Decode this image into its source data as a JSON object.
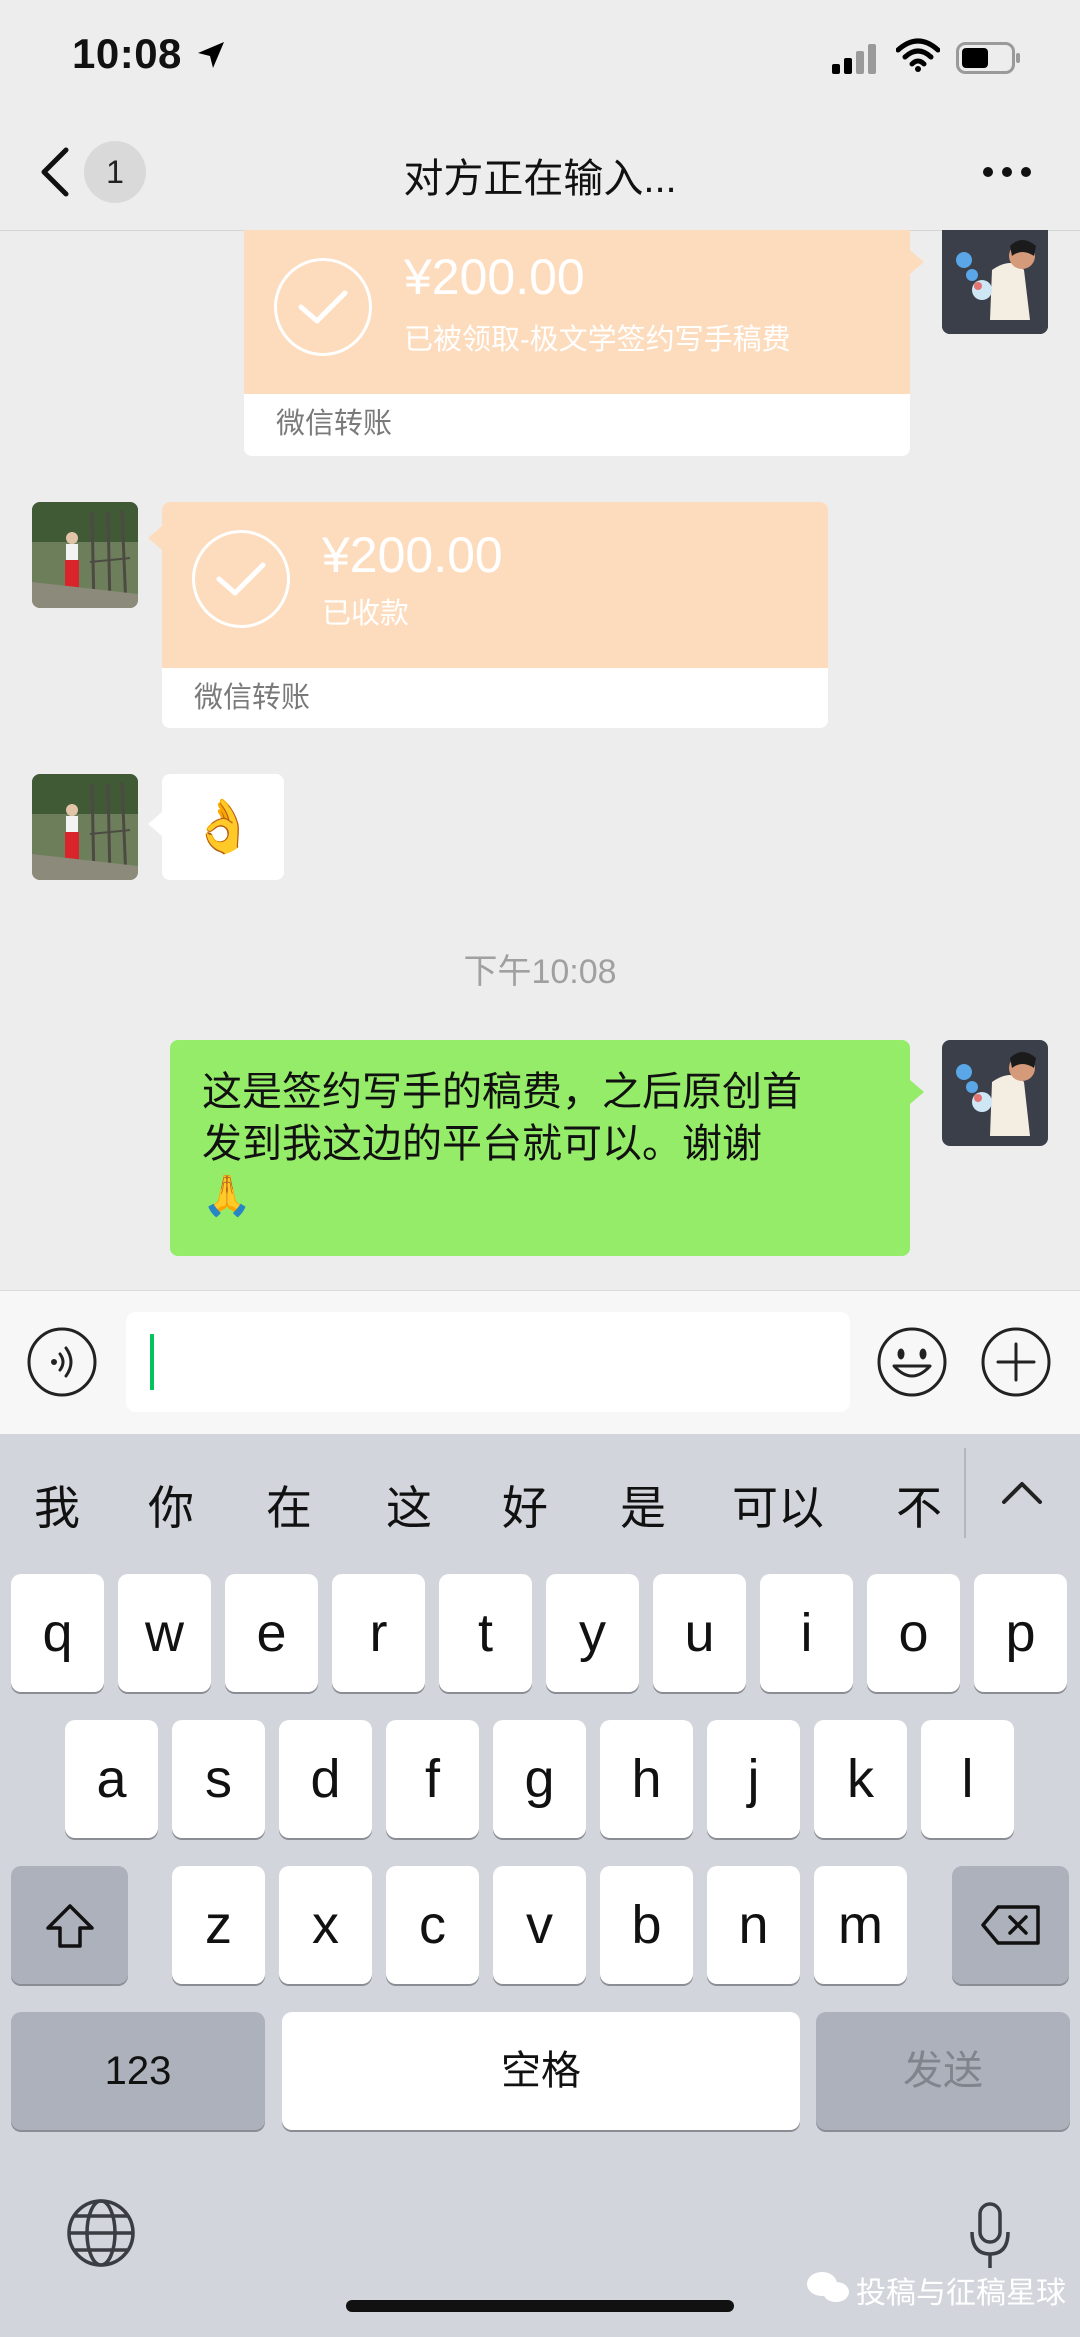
{
  "status_bar": {
    "time": "10:08"
  },
  "nav": {
    "badge": "1",
    "title": "对方正在输入..."
  },
  "messages": {
    "transfer_sent": {
      "amount": "¥200.00",
      "desc": "已被领取-极文学签约写手稿费",
      "footer": "微信转账"
    },
    "transfer_received": {
      "amount": "¥200.00",
      "desc": "已收款",
      "footer": "微信转账"
    },
    "reply_emoji": "👌",
    "timestamp": "下午10:08",
    "text_line1": "这是签约写手的稿费，之后原创首",
    "text_line2": "发到我这边的平台就可以。谢谢",
    "text_emoji": "🙏"
  },
  "keyboard": {
    "candidates": [
      "我",
      "你",
      "在",
      "这",
      "好",
      "是",
      "可以",
      "不"
    ],
    "row1": [
      "q",
      "w",
      "e",
      "r",
      "t",
      "y",
      "u",
      "i",
      "o",
      "p"
    ],
    "row2": [
      "a",
      "s",
      "d",
      "f",
      "g",
      "h",
      "j",
      "k",
      "l"
    ],
    "row3": [
      "z",
      "x",
      "c",
      "v",
      "b",
      "n",
      "m"
    ],
    "numbers_label": "123",
    "space_label": "空格",
    "send_label": "发送"
  },
  "watermark": "投稿与征稿星球",
  "colors": {
    "bubble_green": "#95ec69",
    "transfer_orange": "#fddcbe",
    "accent": "#07c160"
  }
}
